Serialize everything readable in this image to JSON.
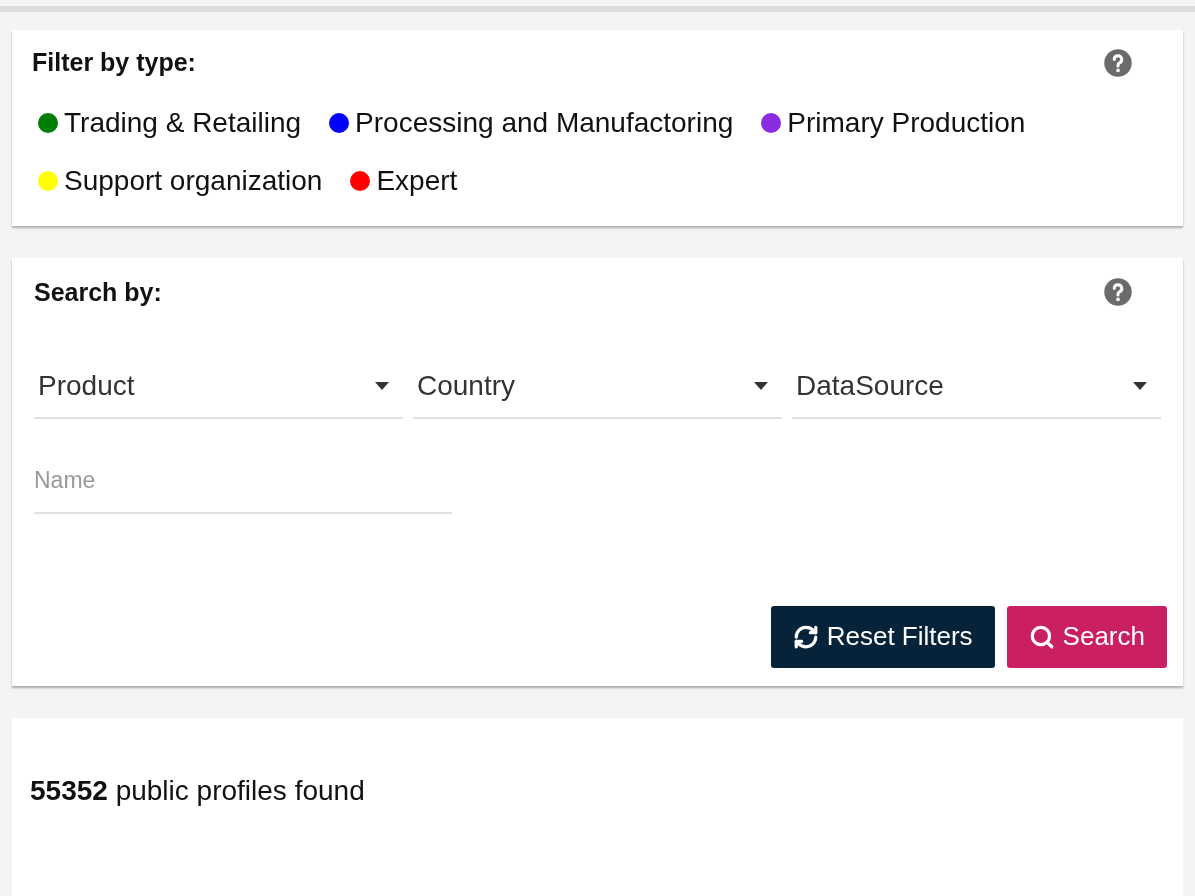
{
  "filter_panel": {
    "title": "Filter by type:",
    "types": [
      {
        "label": "Trading & Retailing",
        "color": "#008000"
      },
      {
        "label": "Processing and Manufactoring",
        "color": "#0000ff"
      },
      {
        "label": "Primary Production",
        "color": "#8a2be2"
      },
      {
        "label": "Support organization",
        "color": "#ffff00"
      },
      {
        "label": "Expert",
        "color": "#ff0000"
      }
    ]
  },
  "search_panel": {
    "title": "Search by:",
    "dropdowns": [
      {
        "label": "Product"
      },
      {
        "label": "Country"
      },
      {
        "label": "DataSource"
      }
    ],
    "name_field": {
      "placeholder": "Name"
    },
    "buttons": [
      {
        "kind": "reset",
        "label": "Reset Filters"
      },
      {
        "kind": "search",
        "label": "Search"
      }
    ]
  },
  "results": {
    "summary": "**55352** public profiles found"
  }
}
